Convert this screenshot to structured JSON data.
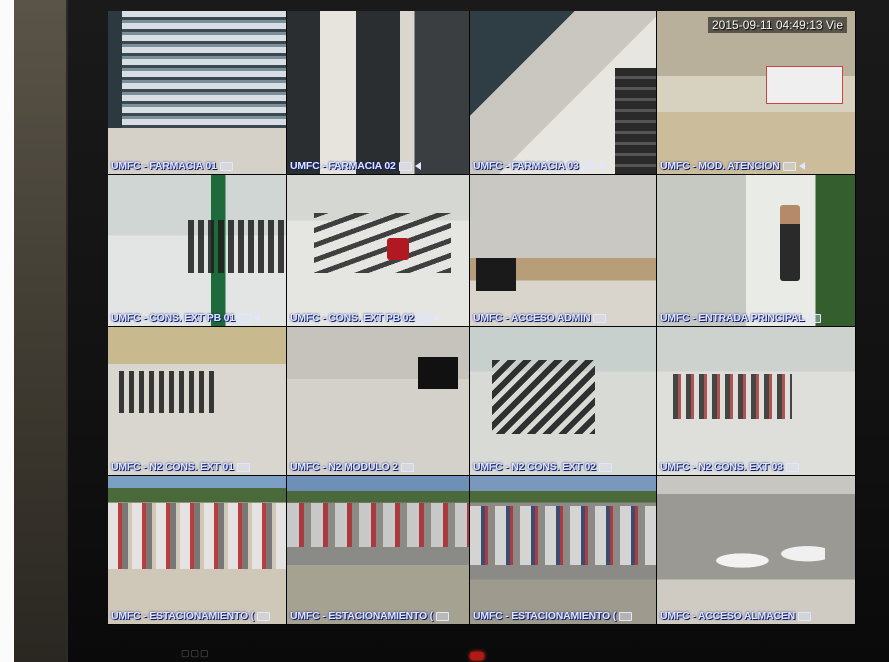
{
  "dvr": {
    "timestamp": "2015-09-11 04:49:13 Vie",
    "cameras": [
      {
        "label": "UMFC - FARMACIA 01"
      },
      {
        "label": "UMFC - FARMACIA 02"
      },
      {
        "label": "UMFC - FARMACIA 03"
      },
      {
        "label": "UMFC - MOD. ATENCION"
      },
      {
        "label": "UMFC - CONS. EXT PB 01"
      },
      {
        "label": "UMFC - CONS. EXT PB 02"
      },
      {
        "label": "UMFC - ACCESO ADMIN"
      },
      {
        "label": "UMFC - ENTRADA PRINCIPAL"
      },
      {
        "label": "UMFC - N2 CONS. EXT 01"
      },
      {
        "label": "UMFC - N2 MODULO 2"
      },
      {
        "label": "UMFC - N2 CONS. EXT 02"
      },
      {
        "label": "UMFC - N2 CONS. EXT 03"
      },
      {
        "label": "UMFC - ESTACIONAMIENTO ("
      },
      {
        "label": "UMFC - ESTACIONAMIENTO ("
      },
      {
        "label": "UMFC - ESTACIONAMIENTO ("
      },
      {
        "label": "UMFC - ACCESO ALMACEN"
      }
    ]
  },
  "colors": {
    "label_text": "#dfe6ff",
    "label_shadow": "#1a2a88",
    "bezel": "#101010",
    "power_led": "#b41a12"
  }
}
